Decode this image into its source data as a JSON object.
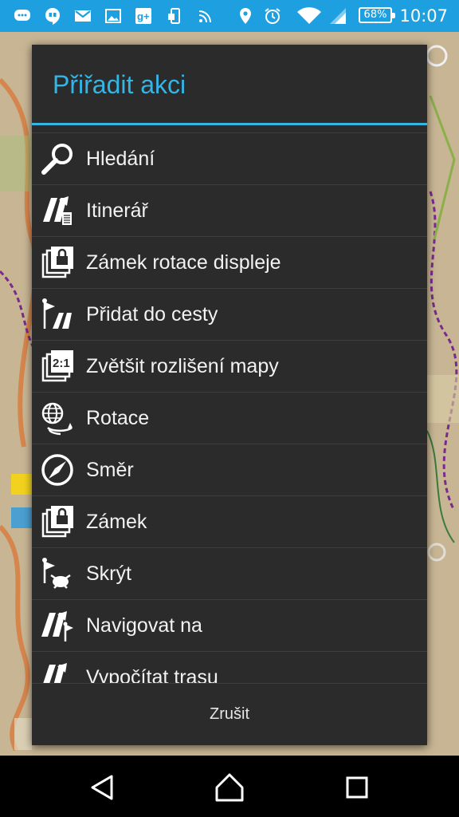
{
  "status_bar": {
    "time": "10:07",
    "battery_percent": "68%",
    "icons": [
      "messages-icon",
      "hangouts-icon",
      "gmail-icon",
      "gallery-icon",
      "google-plus-icon",
      "phone-transfer-icon",
      "nfc-icon",
      "location-icon",
      "alarm-icon",
      "wifi-icon",
      "signal-icon",
      "battery-icon"
    ]
  },
  "dialog": {
    "title": "Přiřadit akci",
    "items": [
      {
        "label": "Hledání",
        "icon": "search-icon"
      },
      {
        "label": "Itinerář",
        "icon": "itinerary-icon"
      },
      {
        "label": "Zámek rotace displeje",
        "icon": "rotation-lock-icon"
      },
      {
        "label": "Přidat do cesty",
        "icon": "add-to-route-icon"
      },
      {
        "label": "Zvětšit rozlišení mapy",
        "icon": "map-resolution-icon"
      },
      {
        "label": "Rotace",
        "icon": "rotation-icon"
      },
      {
        "label": "Směr",
        "icon": "compass-icon"
      },
      {
        "label": "Zámek",
        "icon": "lock-icon"
      },
      {
        "label": "Skrýt",
        "icon": "hide-icon"
      },
      {
        "label": "Navigovat na",
        "icon": "navigate-to-icon"
      },
      {
        "label": "Vypočítat trasu",
        "icon": "calculate-route-icon"
      }
    ],
    "cancel_label": "Zrušit"
  },
  "colors": {
    "status_bar": "#1ea0e0",
    "accent": "#33b5e5",
    "dialog_bg": "#2b2b2b",
    "nav_bar": "#000000"
  },
  "nav_bar": {
    "buttons": [
      "back-icon",
      "home-icon",
      "recents-icon"
    ]
  }
}
